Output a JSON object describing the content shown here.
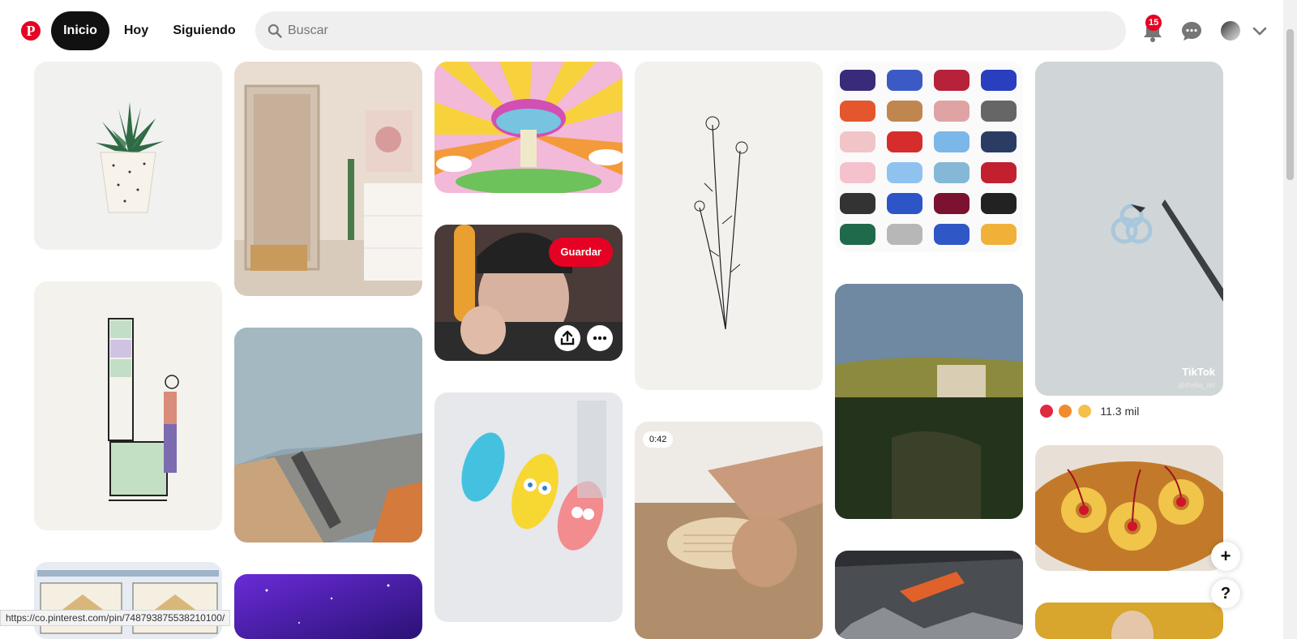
{
  "brand": {
    "logo_letter": "P",
    "color": "#e60023"
  },
  "nav": {
    "home": "Inicio",
    "today": "Hoy",
    "following": "Siguiendo"
  },
  "search": {
    "placeholder": "Buscar"
  },
  "notifications": {
    "count": "15"
  },
  "pins": [
    {
      "kind": "image",
      "subject": "succulent plant in white pot"
    },
    {
      "kind": "image",
      "subject": "bedroom with fairy lights mirror"
    },
    {
      "kind": "image",
      "subject": "psychedelic mushroom illustration"
    },
    {
      "kind": "image",
      "subject": "wildflower line drawing"
    },
    {
      "kind": "image",
      "subject": "sneaker colorway grid"
    },
    {
      "kind": "video",
      "subject": "drawing with pen",
      "overlay_brand": "TikTok",
      "overlay_user": "@thrilla_art"
    },
    {
      "kind": "image",
      "subject": "man portrait",
      "save_label": "Guardar"
    },
    {
      "kind": "image",
      "subject": "kitchen cabinet sketch"
    },
    {
      "kind": "image",
      "subject": "shower floor drain"
    },
    {
      "kind": "image",
      "subject": "painted nails"
    },
    {
      "kind": "video",
      "subject": "hand with wooden sticks",
      "duration": "0:42"
    },
    {
      "kind": "image",
      "subject": "city landscape"
    },
    {
      "kind": "image",
      "subject": "pineapple upside down cake"
    }
  ],
  "reactions": {
    "count": "11.3 mil"
  },
  "fab": {
    "create": "+",
    "help": "?"
  },
  "status_url": "https://co.pinterest.com/pin/748793875538210100/"
}
